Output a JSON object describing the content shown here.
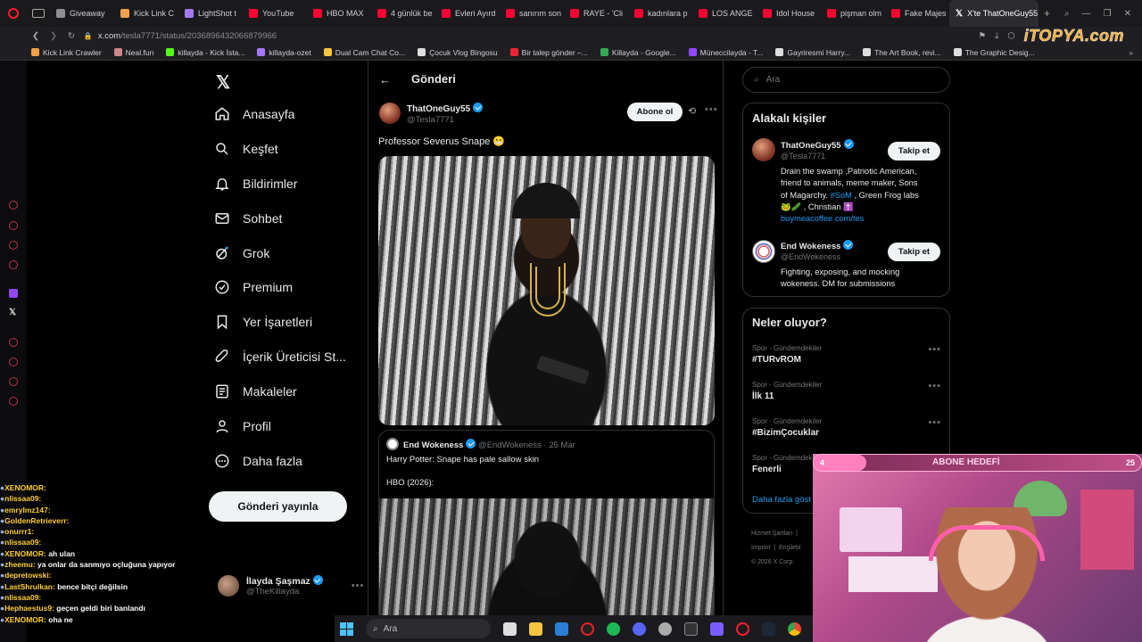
{
  "browser": {
    "tabs": [
      {
        "label": "Giveaway",
        "color": "#8e8e93"
      },
      {
        "label": "Kick Link C",
        "color": "#f1a14a"
      },
      {
        "label": "LightShot t",
        "color": "#a678ff"
      },
      {
        "label": "YouTube",
        "color": "#ff0033"
      },
      {
        "label": "HBO MAX",
        "color": "#ff0033"
      },
      {
        "label": "4 günlük be",
        "color": "#ff0033"
      },
      {
        "label": "Evleri Ayırd",
        "color": "#ff0033"
      },
      {
        "label": "sanırım son",
        "color": "#ff0033"
      },
      {
        "label": "RAYE - 'Cli",
        "color": "#ff0033"
      },
      {
        "label": "kadınlara p",
        "color": "#ff0033"
      },
      {
        "label": "LOS ANGE",
        "color": "#ff0033"
      },
      {
        "label": "Idol House",
        "color": "#ff0033"
      },
      {
        "label": "pişman olm",
        "color": "#ff0033"
      },
      {
        "label": "Fake Majes",
        "color": "#ff0033"
      }
    ],
    "active_tab": "X'te ThatOneGuy55",
    "url_host": "x.com",
    "url_path": "/tesla7771/status/2036896432066879966",
    "watermark": "iTOPYA.com",
    "bookmarks": [
      {
        "label": "Kick Link Crawler",
        "color": "#f1a14a"
      },
      {
        "label": "Neal.fun",
        "color": "#c88"
      },
      {
        "label": "killayda - Kick İsta...",
        "color": "#53fc18"
      },
      {
        "label": "killayda-ozet",
        "color": "#a678ff"
      },
      {
        "label": "Dual Cam Chat Co...",
        "color": "#f5c542"
      },
      {
        "label": "Çocuk Vlog Bingosu",
        "color": "#ddd"
      },
      {
        "label": "Bir talep gönder –...",
        "color": "#e23"
      },
      {
        "label": "Killayda - Google...",
        "color": "#34a853"
      },
      {
        "label": "Müneccilayda - T...",
        "color": "#9146ff"
      },
      {
        "label": "Gayriresmi Harry...",
        "color": "#ddd"
      },
      {
        "label": "The Art Book, revi...",
        "color": "#ddd"
      },
      {
        "label": "The Graphic Desig...",
        "color": "#ddd"
      }
    ]
  },
  "nav": {
    "items": [
      {
        "label": "Anasayfa",
        "icon": "home-icon"
      },
      {
        "label": "Keşfet",
        "icon": "search-icon"
      },
      {
        "label": "Bildirimler",
        "icon": "bell-icon"
      },
      {
        "label": "Sohbet",
        "icon": "mail-icon"
      },
      {
        "label": "Grok",
        "icon": "grok-icon"
      },
      {
        "label": "Premium",
        "icon": "premium-icon"
      },
      {
        "label": "Yer İşaretleri",
        "icon": "bookmark-icon"
      },
      {
        "label": "İçerik Üreticisi St...",
        "icon": "rocket-icon"
      },
      {
        "label": "Makaleler",
        "icon": "article-icon"
      },
      {
        "label": "Profil",
        "icon": "profile-icon"
      },
      {
        "label": "Daha fazla",
        "icon": "more-icon"
      }
    ],
    "post_button": "Gönderi yayınla",
    "account": {
      "name": "İlayda Şaşmaz",
      "handle": "@TheKillayda"
    }
  },
  "post": {
    "header": "Gönderi",
    "author": "ThatOneGuy55",
    "handle": "@Tesla7771",
    "subscribe": "Abone ol",
    "text": "Professor Severus Snape 😬",
    "quote": {
      "author": "End Wokeness",
      "handle": "@EndWokeness",
      "date": "· 25 Mar",
      "line1": "Harry Potter: Snape has pale sallow skin",
      "line2": "HBO (2026):"
    }
  },
  "right": {
    "search_placeholder": "Ara",
    "people_title": "Alakalı kişiler",
    "people": [
      {
        "name": "ThatOneGuy55",
        "handle": "@Tesla7771",
        "follow": "Takip et",
        "bio1": "Drain the swamp ,Patriotic American,",
        "bio2": "friend to animals, meme maker, Sons",
        "bio3a": "of Magarchy. ",
        "bio3link": "#SoM",
        "bio3b": " , Green Frog labs",
        "bio4": "🐸🥒 , Christian ✝️",
        "link": "buymeacoffee.com/tes"
      },
      {
        "name": "End Wokeness",
        "handle": "@EndWokeness",
        "follow": "Takip et",
        "bio1": "Fighting, exposing, and mocking",
        "bio2": "wokeness. DM for submissions"
      }
    ],
    "trends_title": "Neler oluyor?",
    "trends": [
      {
        "cat": "Spor · Gündemdekiler",
        "name": "#TURvROM"
      },
      {
        "cat": "Spor · Gündemdekiler",
        "name": "İlk 11"
      },
      {
        "cat": "Spor · Gündemdekiler",
        "name": "#BizimÇocuklar"
      },
      {
        "cat": "Spor · Gündemdekiler",
        "name": "Fenerli"
      }
    ],
    "show_more": "Daha fazla göst",
    "footer1": "Hizmet Şartları",
    "footer2": "Imprint",
    "footer3": "Erişilebi",
    "copyright": "© 2026 X Corp."
  },
  "stream": {
    "goal_label": "ABONE HEDEFİ",
    "goal_current": "4",
    "goal_target": "25",
    "chat": [
      {
        "user": "XENOMOR:",
        "msg": ""
      },
      {
        "user": "nlissaa09:",
        "msg": ""
      },
      {
        "user": "emrylmz147:",
        "msg": ""
      },
      {
        "user": "GoldenRetrieverr:",
        "msg": ""
      },
      {
        "user": "onurrr1:",
        "msg": ""
      },
      {
        "user": "nlissaa09:",
        "msg": ""
      },
      {
        "user": "XENOMOR:",
        "msg": "ah ulan"
      },
      {
        "user": "zheemu:",
        "msg": "ya onlar da sanmıyo oçluğuna yapıyor"
      },
      {
        "user": "depretowski:",
        "msg": ""
      },
      {
        "user": "LastShrulkan:",
        "msg": "bence bitçi değilsin"
      },
      {
        "user": "nlissaa09:",
        "msg": ""
      },
      {
        "user": "Hephaestus9:",
        "msg": "geçen geldi biri banlandı"
      },
      {
        "user": "XENOMOR:",
        "msg": "oha ne"
      }
    ],
    "taskbar_search": "Ara"
  }
}
